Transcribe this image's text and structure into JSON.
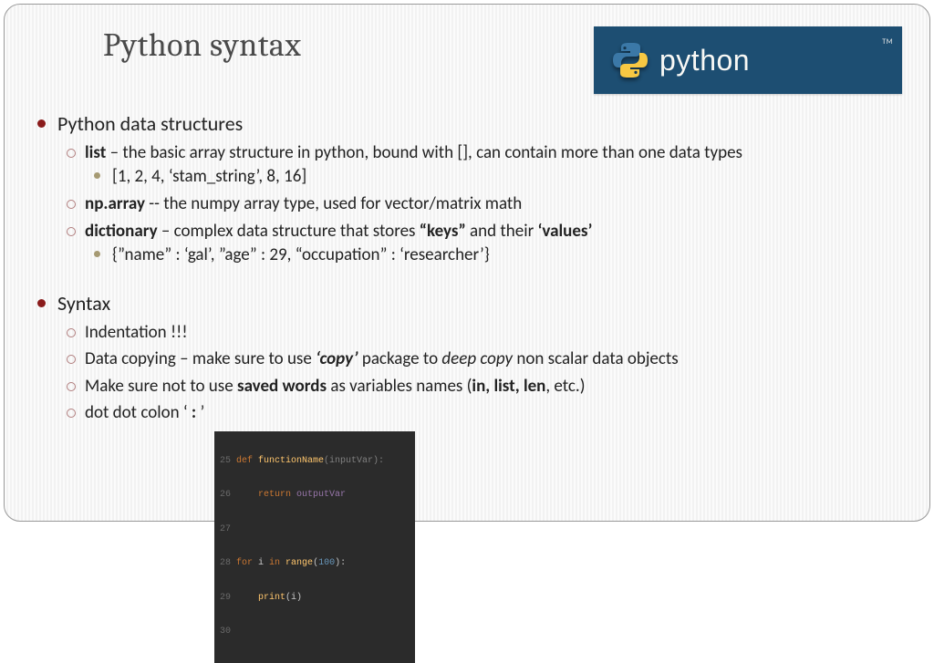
{
  "title": "Python syntax",
  "logo": {
    "word": "python",
    "tm": "TM"
  },
  "sections": {
    "data_structures": {
      "heading": "Python data structures",
      "items": {
        "list": {
          "term": "list",
          "desc": " – the basic array structure in python, bound with [], can contain more than one data types",
          "example": "[1, 2, 4, ‘stam_string’, 8, 16]"
        },
        "nparray": {
          "term": "np.array",
          "desc": "  -- the numpy array type, used for vector/matrix  math"
        },
        "dict": {
          "term": "dictionary",
          "desc_pre": " – complex data structure that stores ",
          "keys": "“keys”",
          "mid": " and their ",
          "values": "‘values’",
          "example": "{”name” :  ‘gal’, ”age” : 29, “occupation” : ‘researcher’}"
        }
      }
    },
    "syntax": {
      "heading": "Syntax",
      "indent": "Indentation !!!",
      "copy": {
        "pre": "Data copying – make sure to use ",
        "pkg": "‘copy’",
        "mid": " package to ",
        "deep": "deep copy",
        "post": " non scalar data objects"
      },
      "saved": {
        "pre": "Make sure not to use ",
        "sw": "saved words",
        "mid": " as variables names (",
        "ex": "in, list, len",
        "post": ", etc.)"
      },
      "colon": {
        "pre": "dot dot colon  ‘ ",
        "c": ":",
        "post": " ’"
      }
    }
  },
  "code": {
    "l25": {
      "n": "25",
      "def": "def ",
      "fn": "functionName",
      "args": "(inputVar):"
    },
    "l26": {
      "n": "26",
      "ret": "return ",
      "var": "outputVar"
    },
    "l27": {
      "n": "27"
    },
    "l28": {
      "n": "28",
      "for": "for ",
      "i": "i",
      "in": " in ",
      "range": "range",
      "lp": "(",
      "num": "100",
      "rp": "):"
    },
    "l29": {
      "n": "29",
      "print": "print",
      "arg": "(i)"
    },
    "l30": {
      "n": "30"
    }
  }
}
